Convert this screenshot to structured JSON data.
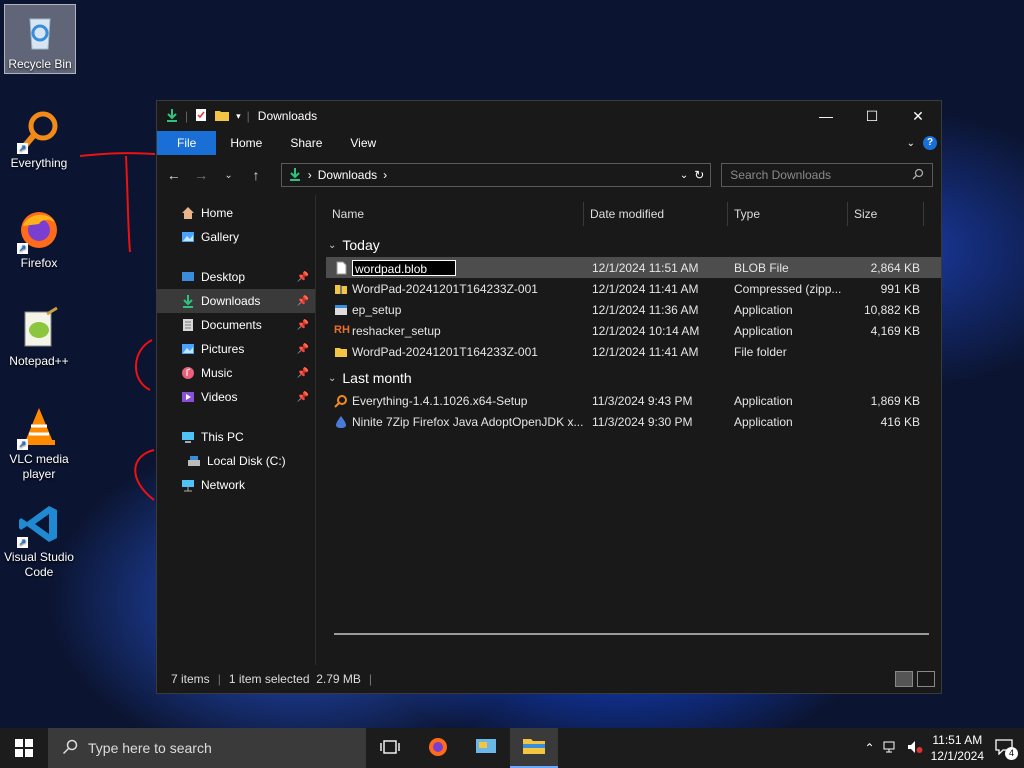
{
  "desktop": {
    "icons": [
      {
        "label": "Recycle Bin",
        "icon": "recycle-bin-icon"
      },
      {
        "label": "Everything",
        "icon": "everything-icon"
      },
      {
        "label": "Firefox",
        "icon": "firefox-icon"
      },
      {
        "label": "Notepad++",
        "icon": "notepadpp-icon"
      },
      {
        "label": "VLC media player",
        "icon": "vlc-icon"
      },
      {
        "label": "Visual Studio Code",
        "icon": "vscode-icon"
      }
    ]
  },
  "window": {
    "title": "Downloads",
    "ribbon_tabs": [
      "File",
      "Home",
      "Share",
      "View"
    ],
    "address": {
      "segment": "Downloads"
    },
    "search_placeholder": "Search Downloads",
    "nav": {
      "items": [
        {
          "label": "Home",
          "icon": "home-icon"
        },
        {
          "label": "Gallery",
          "icon": "gallery-icon"
        },
        {
          "label": "Desktop",
          "icon": "desktop-icon",
          "pinned": true
        },
        {
          "label": "Downloads",
          "icon": "downloads-icon",
          "pinned": true,
          "active": true
        },
        {
          "label": "Documents",
          "icon": "documents-icon",
          "pinned": true
        },
        {
          "label": "Pictures",
          "icon": "pictures-icon",
          "pinned": true
        },
        {
          "label": "Music",
          "icon": "music-icon",
          "pinned": true
        },
        {
          "label": "Videos",
          "icon": "videos-icon",
          "pinned": true
        },
        {
          "label": "This PC",
          "icon": "this-pc-icon"
        },
        {
          "label": "Local Disk (C:)",
          "icon": "local-disk-icon"
        },
        {
          "label": "Network",
          "icon": "network-icon"
        }
      ]
    },
    "columns": [
      "Name",
      "Date modified",
      "Type",
      "Size"
    ],
    "groups": [
      {
        "label": "Today",
        "files": [
          {
            "name": "wordpad.blob",
            "date": "12/1/2024 11:51 AM",
            "type": "BLOB File",
            "size": "2,864 KB",
            "icon": "blank-file-icon",
            "selected": true,
            "renaming": true
          },
          {
            "name": "WordPad-20241201T164233Z-001",
            "date": "12/1/2024 11:41 AM",
            "type": "Compressed (zipp...",
            "size": "991 KB",
            "icon": "zip-folder-icon"
          },
          {
            "name": "ep_setup",
            "date": "12/1/2024 11:36 AM",
            "type": "Application",
            "size": "10,882 KB",
            "icon": "app-icon"
          },
          {
            "name": "reshacker_setup",
            "date": "12/1/2024 10:14 AM",
            "type": "Application",
            "size": "4,169 KB",
            "icon": "reshacker-icon"
          },
          {
            "name": "WordPad-20241201T164233Z-001",
            "date": "12/1/2024 11:41 AM",
            "type": "File folder",
            "size": "",
            "icon": "folder-icon"
          }
        ]
      },
      {
        "label": "Last month",
        "files": [
          {
            "name": "Everything-1.4.1.1026.x64-Setup",
            "date": "11/3/2024 9:43 PM",
            "type": "Application",
            "size": "1,869 KB",
            "icon": "everything-icon"
          },
          {
            "name": "Ninite 7Zip Firefox Java AdoptOpenJDK x...",
            "date": "11/3/2024 9:30 PM",
            "type": "Application",
            "size": "416 KB",
            "icon": "ninite-icon"
          }
        ]
      }
    ],
    "status": {
      "items": "7 items",
      "selection": "1 item selected  2.79 MB"
    }
  },
  "taskbar": {
    "search_placeholder": "Type here to search",
    "time": "11:51 AM",
    "date": "12/1/2024",
    "notifications": "4"
  },
  "colors": {
    "accent": "#1a6fd6",
    "window_bg": "#191919",
    "selected_row": "#4d4d4d"
  }
}
